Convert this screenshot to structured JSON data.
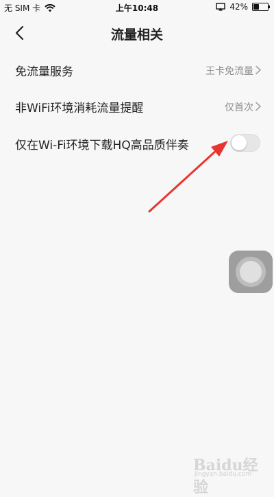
{
  "status_bar": {
    "carrier": "无 SIM 卡",
    "time": "上午10:48",
    "battery_percent": "42%",
    "battery_level": 0.42
  },
  "nav": {
    "title": "流量相关"
  },
  "settings": {
    "items": [
      {
        "label": "免流量服务",
        "value": "王卡免流量"
      },
      {
        "label": "非WiFi环境消耗流量提醒",
        "value": "仅首次"
      },
      {
        "label": "仅在Wi-Fi环境下载HQ高品质伴奏",
        "toggle_on": false
      }
    ]
  },
  "annotation": {
    "color": "#e8352f"
  },
  "watermark": {
    "text": "Baidu经验",
    "sub": "jingyan.baidu.com"
  }
}
